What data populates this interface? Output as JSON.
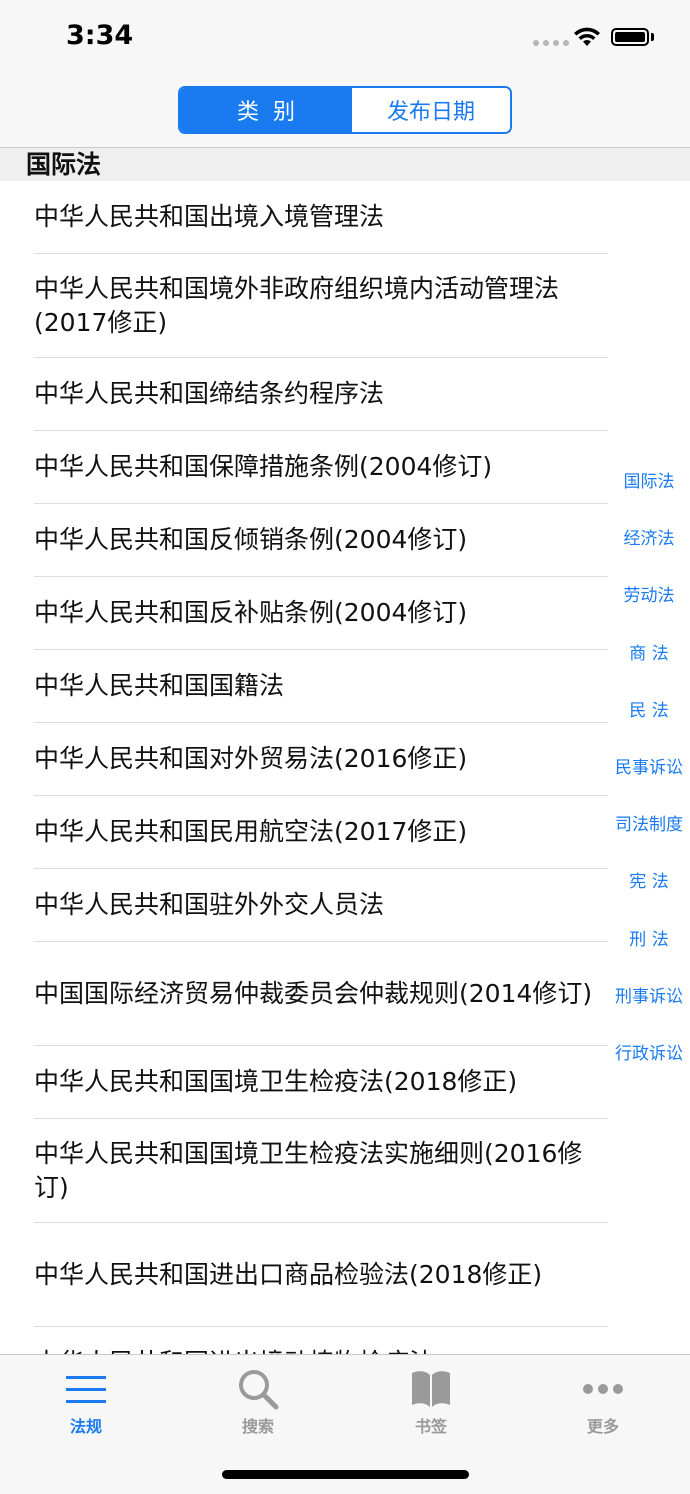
{
  "status": {
    "time": "3:34"
  },
  "segmented": {
    "selected": "类别",
    "other": "发布日期"
  },
  "section": {
    "title": "国际法"
  },
  "rows": [
    "中华人民共和国出境入境管理法",
    "中华人民共和国境外非政府组织境内活动管理法(2017修正)",
    "中华人民共和国缔结条约程序法",
    "中华人民共和国保障措施条例(2004修订)",
    "中华人民共和国反倾销条例(2004修订)",
    "中华人民共和国反补贴条例(2004修订)",
    "中华人民共和国国籍法",
    "中华人民共和国对外贸易法(2016修正)",
    "中华人民共和国民用航空法(2017修正)",
    "中华人民共和国驻外外交人员法",
    "中国国际经济贸易仲裁委员会仲裁规则(2014修订)",
    "中华人民共和国国境卫生检疫法(2018修正)",
    "中华人民共和国国境卫生检疫法实施细则(2016修订)",
    "中华人民共和国进出口商品检验法(2018修正)",
    "中华人民共和国进出境动植物检疫法"
  ],
  "index": [
    "国际法",
    "经济法",
    "劳动法",
    "商 法",
    "民 法",
    "民事诉讼",
    "司法制度",
    "宪 法",
    "刑 法",
    "刑事诉讼",
    "行政诉讼"
  ],
  "tabs": [
    {
      "label": "法规",
      "icon": "list-icon",
      "active": true
    },
    {
      "label": "搜索",
      "icon": "search-icon",
      "active": false
    },
    {
      "label": "书签",
      "icon": "book-icon",
      "active": false
    },
    {
      "label": "更多",
      "icon": "more-icon",
      "active": false
    }
  ],
  "colors": {
    "accent": "#1a7bf0",
    "inactive": "#9a9a9a"
  }
}
